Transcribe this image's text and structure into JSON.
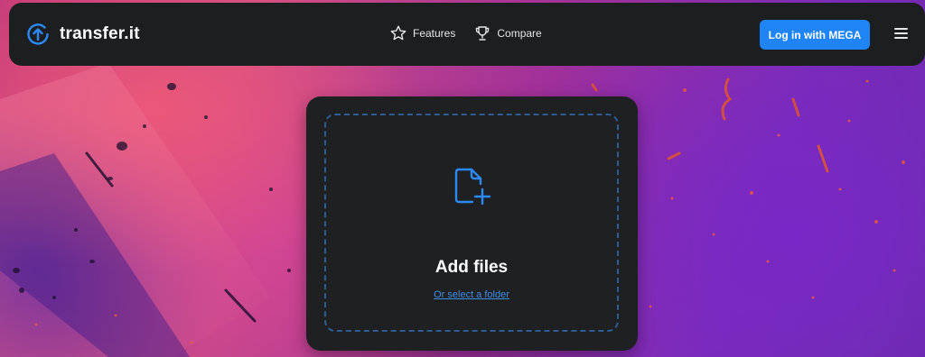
{
  "brand": {
    "name": "transfer.it",
    "logo_icon": "upload-arrow-circle-icon",
    "accent_color": "#1f84f5"
  },
  "nav": {
    "items": [
      {
        "label": "Features",
        "icon": "star-icon"
      },
      {
        "label": "Compare",
        "icon": "trophy-icon"
      }
    ],
    "login_label": "Log in with MEGA",
    "menu_icon": "hamburger-menu-icon"
  },
  "upload": {
    "icon": "file-plus-icon",
    "title": "Add files",
    "folder_link": "Or select a folder"
  }
}
